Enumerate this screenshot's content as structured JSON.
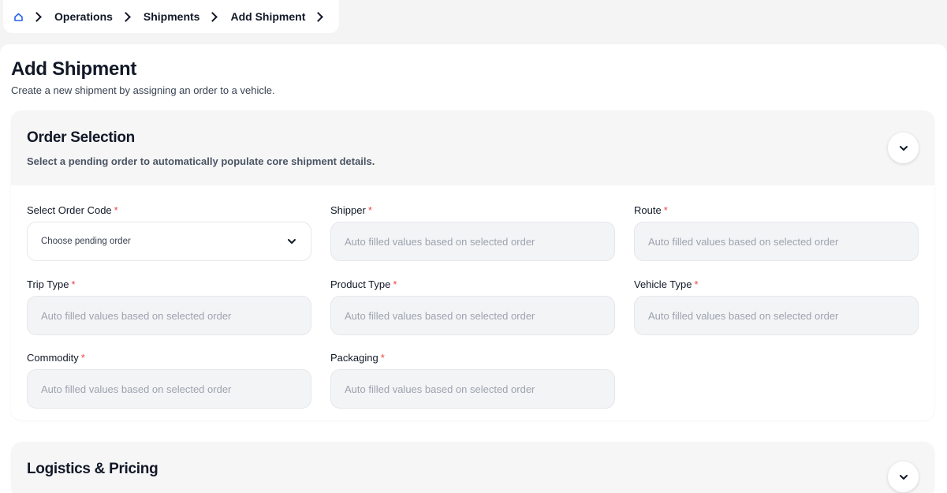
{
  "breadcrumb": {
    "items": [
      "Operations",
      "Shipments",
      "Add Shipment"
    ]
  },
  "page": {
    "title": "Add Shipment",
    "subtitle": "Create a new shipment by assigning an order to a vehicle."
  },
  "order_selection": {
    "title": "Order Selection",
    "description": "Select a pending order to automatically populate core shipment details.",
    "fields": {
      "order_code": {
        "label": "Select Order Code",
        "required": "*",
        "value": "Choose pending order"
      },
      "shipper": {
        "label": "Shipper",
        "required": "*",
        "placeholder": "Auto filled values based on selected order"
      },
      "route": {
        "label": "Route",
        "required": "*",
        "placeholder": "Auto filled values based on selected order"
      },
      "trip_type": {
        "label": "Trip Type",
        "required": "*",
        "placeholder": "Auto filled values based on selected order"
      },
      "product_type": {
        "label": "Product Type",
        "required": "*",
        "placeholder": "Auto filled values based on selected order"
      },
      "vehicle_type": {
        "label": "Vehicle Type",
        "required": "*",
        "placeholder": "Auto filled values based on selected order"
      },
      "commodity": {
        "label": "Commodity",
        "required": "*",
        "placeholder": "Auto filled values based on selected order"
      },
      "packaging": {
        "label": "Packaging",
        "required": "*",
        "placeholder": "Auto filled values based on selected order"
      }
    }
  },
  "logistics_pricing": {
    "title": "Logistics & Pricing"
  },
  "icons": {
    "home": "home-icon",
    "separator": "chevron-right-icon",
    "expand": "chevron-down-icon",
    "dropdown": "chevron-down-icon"
  },
  "colors": {
    "accent": "#2563eb",
    "required": "#ef4444"
  }
}
